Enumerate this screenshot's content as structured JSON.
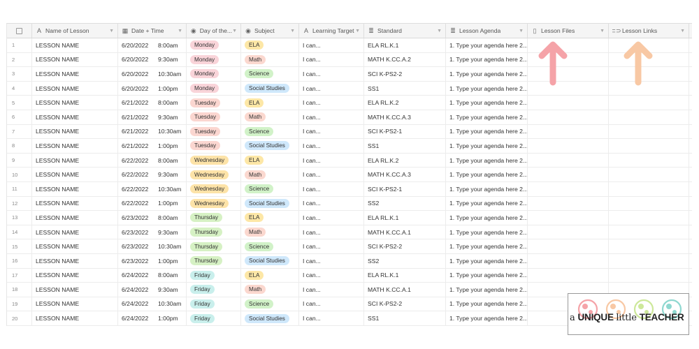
{
  "columns": [
    {
      "label": "Name of Lesson",
      "icon": "text-field-icon"
    },
    {
      "label": "Date + Time",
      "icon": "calendar-icon"
    },
    {
      "label": "Day of the...",
      "icon": "single-select-icon"
    },
    {
      "label": "Subject",
      "icon": "single-select-icon"
    },
    {
      "label": "Learning Target",
      "icon": "text-field-icon"
    },
    {
      "label": "Standard",
      "icon": "long-text-icon"
    },
    {
      "label": "Lesson Agenda",
      "icon": "long-text-icon"
    },
    {
      "label": "Lesson Files",
      "icon": "attachment-icon"
    },
    {
      "label": "Lesson Links",
      "icon": "link-icon"
    }
  ],
  "colors": {
    "Monday": "#f9d4d9",
    "Tuesday": "#fbd6d0",
    "Wednesday": "#fde3a8",
    "Thursday": "#d6f1c4",
    "Friday": "#c9efec",
    "ELA": "#fde7a6",
    "Math": "#fbd8cf",
    "Science": "#d1f2c8",
    "Social Studies": "#cfe8fb",
    "arrow_pink": "#f5a3a8",
    "arrow_peach": "#f8c8a4"
  },
  "rows": [
    {
      "n": "1",
      "name": "LESSON NAME",
      "date": "6/20/2022",
      "time": "8:00am",
      "day": "Monday",
      "subject": "ELA",
      "target": "I can...",
      "standard": "ELA RL.K.1",
      "agenda": "1. Type your agenda here 2..."
    },
    {
      "n": "2",
      "name": "LESSON NAME",
      "date": "6/20/2022",
      "time": "9:30am",
      "day": "Monday",
      "subject": "Math",
      "target": "I can...",
      "standard": "MATH K.CC.A.2",
      "agenda": "1. Type your agenda here 2..."
    },
    {
      "n": "3",
      "name": "LESSON NAME",
      "date": "6/20/2022",
      "time": "10:30am",
      "day": "Monday",
      "subject": "Science",
      "target": "I can...",
      "standard": "SCI K-PS2-2",
      "agenda": "1. Type your agenda here 2..."
    },
    {
      "n": "4",
      "name": "LESSON NAME",
      "date": "6/20/2022",
      "time": "1:00pm",
      "day": "Monday",
      "subject": "Social Studies",
      "target": "I can...",
      "standard": "SS1",
      "agenda": "1. Type your agenda here 2..."
    },
    {
      "n": "5",
      "name": "LESSON NAME",
      "date": "6/21/2022",
      "time": "8:00am",
      "day": "Tuesday",
      "subject": "ELA",
      "target": "I can...",
      "standard": "ELA RL.K.2",
      "agenda": "1. Type your agenda here 2..."
    },
    {
      "n": "6",
      "name": "LESSON NAME",
      "date": "6/21/2022",
      "time": "9:30am",
      "day": "Tuesday",
      "subject": "Math",
      "target": "I can...",
      "standard": "MATH K.CC.A.3",
      "agenda": "1. Type your agenda here 2..."
    },
    {
      "n": "7",
      "name": "LESSON NAME",
      "date": "6/21/2022",
      "time": "10:30am",
      "day": "Tuesday",
      "subject": "Science",
      "target": "I can...",
      "standard": "SCI K-PS2-1",
      "agenda": "1. Type your agenda here 2..."
    },
    {
      "n": "8",
      "name": "LESSON NAME",
      "date": "6/21/2022",
      "time": "1:00pm",
      "day": "Tuesday",
      "subject": "Social Studies",
      "target": "I can...",
      "standard": "SS1",
      "agenda": "1. Type your agenda here 2..."
    },
    {
      "n": "9",
      "name": "LESSON NAME",
      "date": "6/22/2022",
      "time": "8:00am",
      "day": "Wednesday",
      "subject": "ELA",
      "target": "I can...",
      "standard": "ELA RL.K.2",
      "agenda": "1. Type your agenda here 2..."
    },
    {
      "n": "10",
      "name": "LESSON NAME",
      "date": "6/22/2022",
      "time": "9:30am",
      "day": "Wednesday",
      "subject": "Math",
      "target": "I can...",
      "standard": "MATH K.CC.A.3",
      "agenda": "1. Type your agenda here 2..."
    },
    {
      "n": "11",
      "name": "LESSON NAME",
      "date": "6/22/2022",
      "time": "10:30am",
      "day": "Wednesday",
      "subject": "Science",
      "target": "I can...",
      "standard": "SCI K-PS2-1",
      "agenda": "1. Type your agenda here 2..."
    },
    {
      "n": "12",
      "name": "LESSON NAME",
      "date": "6/22/2022",
      "time": "1:00pm",
      "day": "Wednesday",
      "subject": "Social Studies",
      "target": "I can...",
      "standard": "SS2",
      "agenda": "1. Type your agenda here 2..."
    },
    {
      "n": "13",
      "name": "LESSON NAME",
      "date": "6/23/2022",
      "time": "8:00am",
      "day": "Thursday",
      "subject": "ELA",
      "target": "I can...",
      "standard": "ELA RL.K.1",
      "agenda": "1. Type your agenda here 2..."
    },
    {
      "n": "14",
      "name": "LESSON NAME",
      "date": "6/23/2022",
      "time": "9:30am",
      "day": "Thursday",
      "subject": "Math",
      "target": "I can...",
      "standard": "MATH K.CC.A.1",
      "agenda": "1. Type your agenda here 2..."
    },
    {
      "n": "15",
      "name": "LESSON NAME",
      "date": "6/23/2022",
      "time": "10:30am",
      "day": "Thursday",
      "subject": "Science",
      "target": "I can...",
      "standard": "SCI K-PS2-2",
      "agenda": "1. Type your agenda here 2..."
    },
    {
      "n": "16",
      "name": "LESSON NAME",
      "date": "6/23/2022",
      "time": "1:00pm",
      "day": "Thursday",
      "subject": "Social Studies",
      "target": "I can...",
      "standard": "SS2",
      "agenda": "1. Type your agenda here 2..."
    },
    {
      "n": "17",
      "name": "LESSON NAME",
      "date": "6/24/2022",
      "time": "8:00am",
      "day": "Friday",
      "subject": "ELA",
      "target": "I can...",
      "standard": "ELA RL.K.1",
      "agenda": "1. Type your agenda here 2..."
    },
    {
      "n": "18",
      "name": "LESSON NAME",
      "date": "6/24/2022",
      "time": "9:30am",
      "day": "Friday",
      "subject": "Math",
      "target": "I can...",
      "standard": "MATH K.CC.A.1",
      "agenda": "1. Type your agenda here 2..."
    },
    {
      "n": "19",
      "name": "LESSON NAME",
      "date": "6/24/2022",
      "time": "10:30am",
      "day": "Friday",
      "subject": "Science",
      "target": "I can...",
      "standard": "SCI K-PS2-2",
      "agenda": "1. Type your agenda here 2..."
    },
    {
      "n": "20",
      "name": "LESSON NAME",
      "date": "6/24/2022",
      "time": "1:00pm",
      "day": "Friday",
      "subject": "Social Studies",
      "target": "I can...",
      "standard": "SS1",
      "agenda": "1. Type your agenda here 2..."
    }
  ],
  "logo": {
    "prefix": "a ",
    "unique": "UNIQUE ",
    "little": "little ",
    "teacher": "TEACHER"
  }
}
